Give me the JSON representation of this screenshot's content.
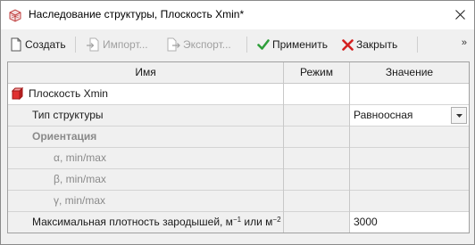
{
  "window": {
    "title": "Наследование структуры, Плоскость Xmin*",
    "app_icon": "structure-cube-icon"
  },
  "toolbar": {
    "create_label": "Создать",
    "import_label": "Импорт...",
    "export_label": "Экспорт...",
    "apply_label": "Применить",
    "close_label": "Закрыть",
    "more_label": "»",
    "apply_color": "#2e9e3a",
    "close_color": "#d42020"
  },
  "table": {
    "columns": [
      "Имя",
      "Режим",
      "Значение"
    ],
    "rows": [
      {
        "name": "Плоскость Xmin",
        "mode": "",
        "value": "",
        "style": "root"
      },
      {
        "name": "Тип структуры",
        "mode": "",
        "value": "Равноосная",
        "style": "combo"
      },
      {
        "name": "Ориентация",
        "mode": "",
        "value": "",
        "style": "group-disabled"
      },
      {
        "name": "α, min/max",
        "mode": "",
        "value": "",
        "style": "sub-disabled"
      },
      {
        "name": "β, min/max",
        "mode": "",
        "value": "",
        "style": "sub-disabled"
      },
      {
        "name": "γ, min/max",
        "mode": "",
        "value": "",
        "style": "sub-disabled"
      },
      {
        "name_main": "Максимальная плотность зародышей, м",
        "name_sup1": "−1",
        "name_mid": " или м",
        "name_sup2": "−2",
        "mode": "",
        "value": "3000",
        "style": "normal"
      }
    ]
  }
}
